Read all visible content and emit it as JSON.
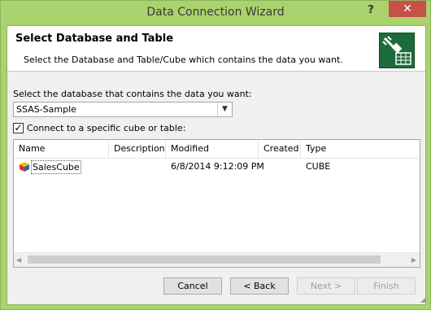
{
  "window": {
    "title": "Data Connection Wizard",
    "help_glyph": "?",
    "close_glyph": "✕"
  },
  "header": {
    "title": "Select Database and Table",
    "description": "Select the Database and Table/Cube which contains the data you want."
  },
  "database": {
    "label": "Select the database that contains the data you want:",
    "selected": "SSAS-Sample"
  },
  "connect_checkbox": {
    "label": "Connect to a specific cube or table:",
    "checked": true,
    "check_glyph": "✓"
  },
  "table": {
    "columns": [
      "Name",
      "Description",
      "Modified",
      "Created",
      "Type"
    ],
    "rows": [
      {
        "name": "SalesCube",
        "description": "",
        "modified": "6/8/2014 9:12:09 PM",
        "created": "",
        "type": "CUBE"
      }
    ]
  },
  "buttons": {
    "cancel": "Cancel",
    "back": "< Back",
    "next": "Next >",
    "finish": "Finish"
  },
  "colors": {
    "title_bar": "#a9d36c",
    "close_button": "#c7504b",
    "header_icon": "#1d6b3a"
  },
  "icons": {
    "header": "data-plug-icon",
    "cube": "cube-icon"
  }
}
